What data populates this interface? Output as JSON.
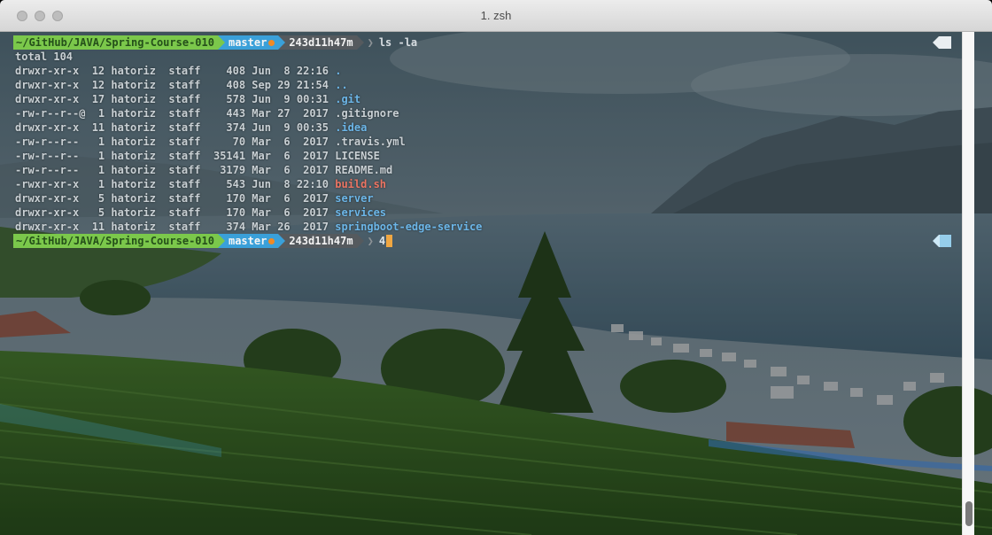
{
  "window": {
    "title": "1. zsh"
  },
  "colors": {
    "prompt_path_bg": "#7bc84b",
    "prompt_branch_bg": "#3aa0d9",
    "prompt_hash_bg": "#555a5e",
    "dir_color": "#6cb6e8",
    "exec_color": "#ec7563",
    "cursor": "#f0a742"
  },
  "prompt": {
    "path": "~/GitHub/JAVA/Spring-Course-010",
    "branch": "master",
    "hash": "243d11h47m"
  },
  "commands": {
    "first": "ls -la",
    "current": "4"
  },
  "listing": {
    "total": "total 104",
    "rows": [
      {
        "text": "drwxr-xr-x  12 hatoriz  staff    408 Jun  8 22:16 ",
        "name": ".",
        "kind": "dir"
      },
      {
        "text": "drwxr-xr-x  12 hatoriz  staff    408 Sep 29 21:54 ",
        "name": "..",
        "kind": "dir"
      },
      {
        "text": "drwxr-xr-x  17 hatoriz  staff    578 Jun  9 00:31 ",
        "name": ".git",
        "kind": "dir"
      },
      {
        "text": "-rw-r--r--@  1 hatoriz  staff    443 Mar 27  2017 ",
        "name": ".gitignore",
        "kind": "file"
      },
      {
        "text": "drwxr-xr-x  11 hatoriz  staff    374 Jun  9 00:35 ",
        "name": ".idea",
        "kind": "dir"
      },
      {
        "text": "-rw-r--r--   1 hatoriz  staff     70 Mar  6  2017 ",
        "name": ".travis.yml",
        "kind": "file"
      },
      {
        "text": "-rw-r--r--   1 hatoriz  staff  35141 Mar  6  2017 ",
        "name": "LICENSE",
        "kind": "file"
      },
      {
        "text": "-rw-r--r--   1 hatoriz  staff   3179 Mar  6  2017 ",
        "name": "README.md",
        "kind": "file"
      },
      {
        "text": "-rwxr-xr-x   1 hatoriz  staff    543 Jun  8 22:10 ",
        "name": "build.sh",
        "kind": "exec"
      },
      {
        "text": "drwxr-xr-x   5 hatoriz  staff    170 Mar  6  2017 ",
        "name": "server",
        "kind": "dir"
      },
      {
        "text": "drwxr-xr-x   5 hatoriz  staff    170 Mar  6  2017 ",
        "name": "services",
        "kind": "dir"
      },
      {
        "text": "drwxr-xr-x  11 hatoriz  staff    374 Mar 26  2017 ",
        "name": "springboot-edge-service",
        "kind": "dir"
      }
    ]
  }
}
